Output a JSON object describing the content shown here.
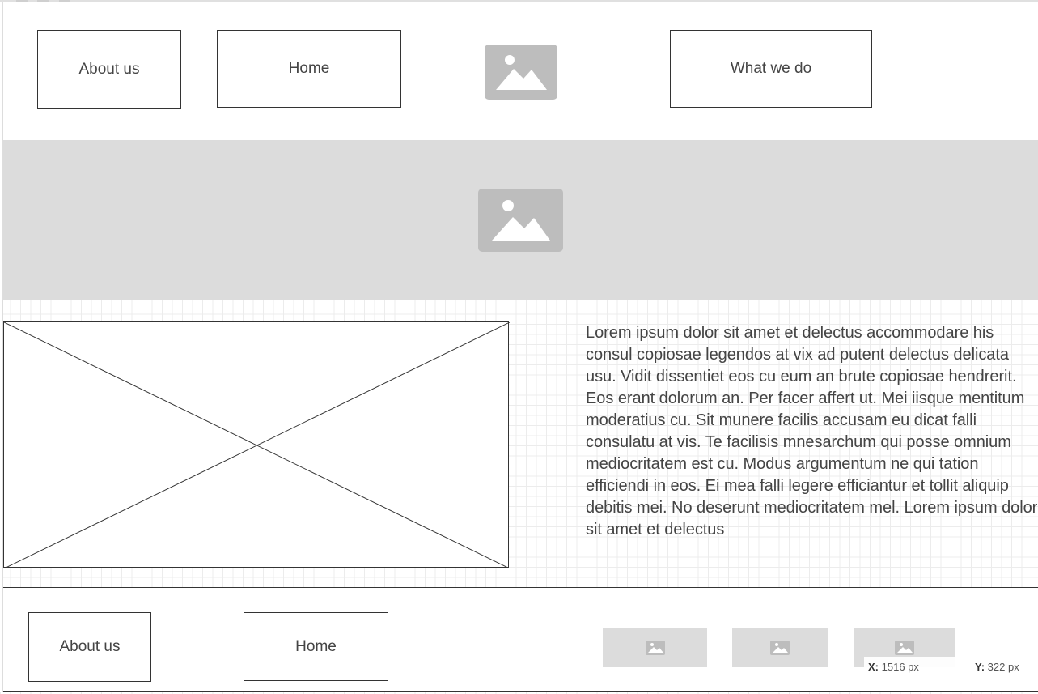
{
  "header": {
    "nav_about": "About us",
    "nav_home": "Home",
    "nav_what": "What we do",
    "logo_icon": "image-icon"
  },
  "hero": {
    "icon": "image-icon"
  },
  "content": {
    "placeholder_icon": "x-placeholder",
    "paragraph": "Lorem ipsum dolor sit amet et delectus accommodare his consul copiosae legendos at vix ad putent delectus delicata usu. Vidit dissentiet eos cu eum an brute copiosae hendrerit. Eos erant dolorum an. Per facer affert ut. Mei iisque mentitum moderatius cu. Sit munere facilis accusam eu dicat falli consulatu at vis. Te facilisis mnesarchum qui posse omnium mediocritatem est cu. Modus argumentum ne qui tation efficiendi in eos. Ei mea falli legere efficiantur et tollit aliquip debitis mei. No deserunt mediocritatem mel. Lorem ipsum dolor sit amet et delectus"
  },
  "footer": {
    "nav_about": "About us",
    "nav_home": "Home",
    "thumbs": [
      "image-icon",
      "image-icon",
      "image-icon"
    ]
  },
  "coords": {
    "x_label": "X:",
    "x_value": "1516 px",
    "y_label": "Y:",
    "y_value": "322 px"
  },
  "colors": {
    "placeholder_gray": "#bdbdbd",
    "panel_gray": "#dcdcdc",
    "border": "#333333"
  }
}
